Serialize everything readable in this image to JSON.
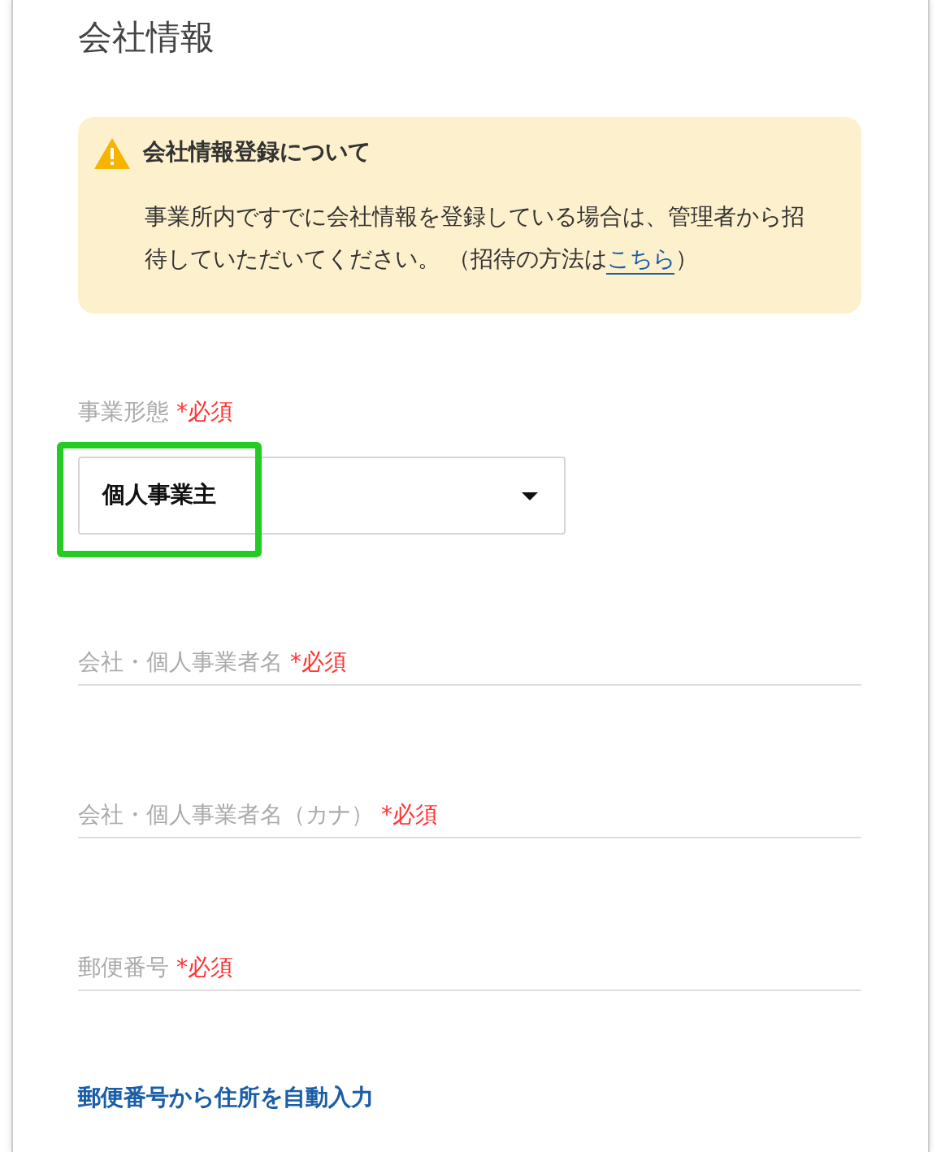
{
  "title": "会社情報",
  "notice": {
    "title": "会社情報登録について",
    "body_before": "事業所内ですでに会社情報を登録している場合は、管理者から招待していただいてください。 （招待の方法は",
    "link": "こちら",
    "body_after": "）"
  },
  "fields": [
    {
      "kind": "select",
      "label": "事業形態",
      "required": "*必須",
      "value": "個人事業主",
      "highlighted": true
    },
    {
      "kind": "text",
      "label": "会社・個人事業者名",
      "required": "*必須"
    },
    {
      "kind": "text",
      "label": "会社・個人事業者名（カナ）",
      "required": "*必須"
    },
    {
      "kind": "text",
      "label": "郵便番号",
      "required": "*必須"
    }
  ],
  "autofill_link": "郵便番号から住所を自動入力"
}
